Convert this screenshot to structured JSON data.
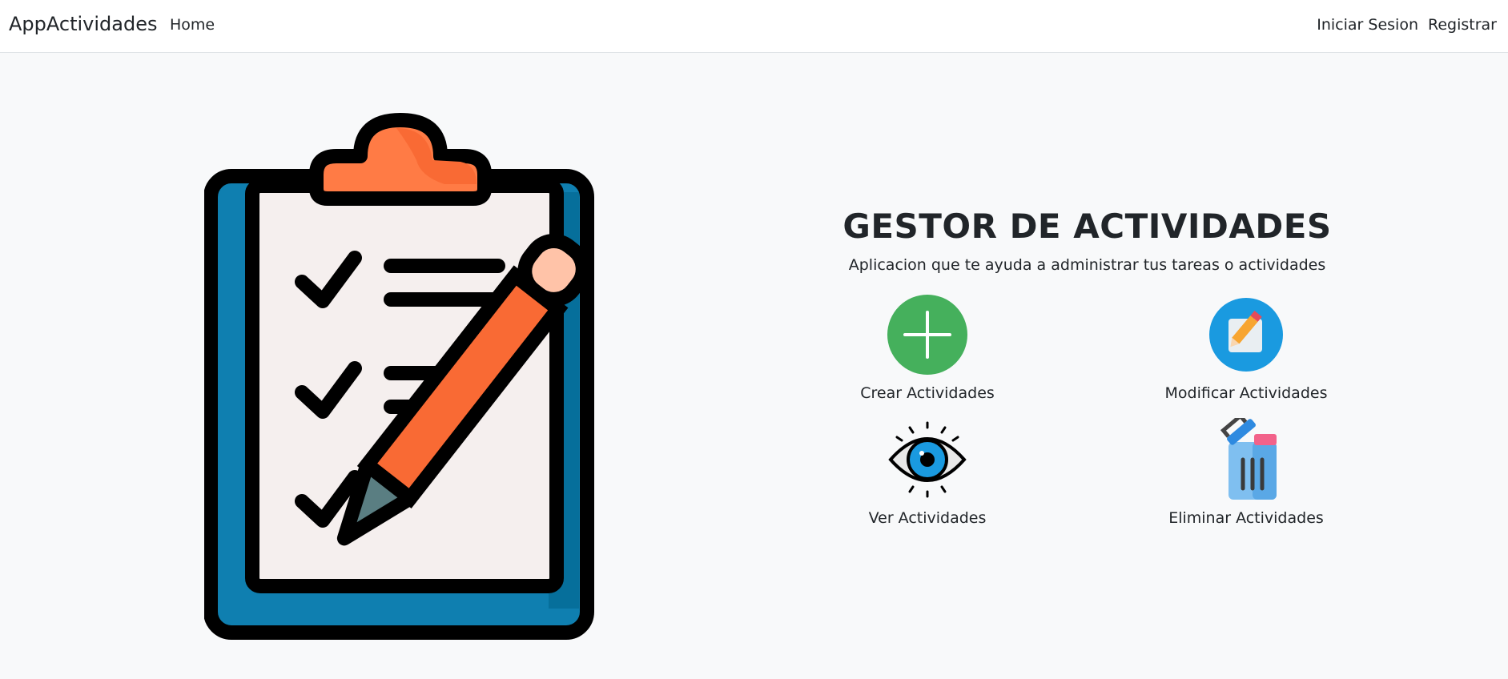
{
  "navbar": {
    "brand": "AppActividades",
    "home": "Home",
    "login": "Iniciar Sesion",
    "register": "Registrar"
  },
  "hero": {
    "title": "GESTOR DE ACTIVIDADES",
    "subtitle": "Aplicacion que te ayuda a administrar tus tareas o actividades",
    "illustration": "clipboard-checklist-with-pencil"
  },
  "actions": [
    {
      "label": "Crear Actividades",
      "icon": "plus-circle-icon",
      "color": "#45b05c"
    },
    {
      "label": "Modificar Actividades",
      "icon": "edit-note-icon",
      "color": "#1a9ae0"
    },
    {
      "label": "Ver Actividades",
      "icon": "eye-icon",
      "color": "#1a9ae0"
    },
    {
      "label": "Eliminar Actividades",
      "icon": "trash-icon",
      "color": "#7fbff0"
    }
  ],
  "colors": {
    "background": "#f8f9fa",
    "navbar": "#ffffff",
    "clipboard_blue": "#0f7fb0",
    "clip_orange": "#ff7b45",
    "pencil_orange": "#f96a34",
    "paper": "#f5efee"
  }
}
